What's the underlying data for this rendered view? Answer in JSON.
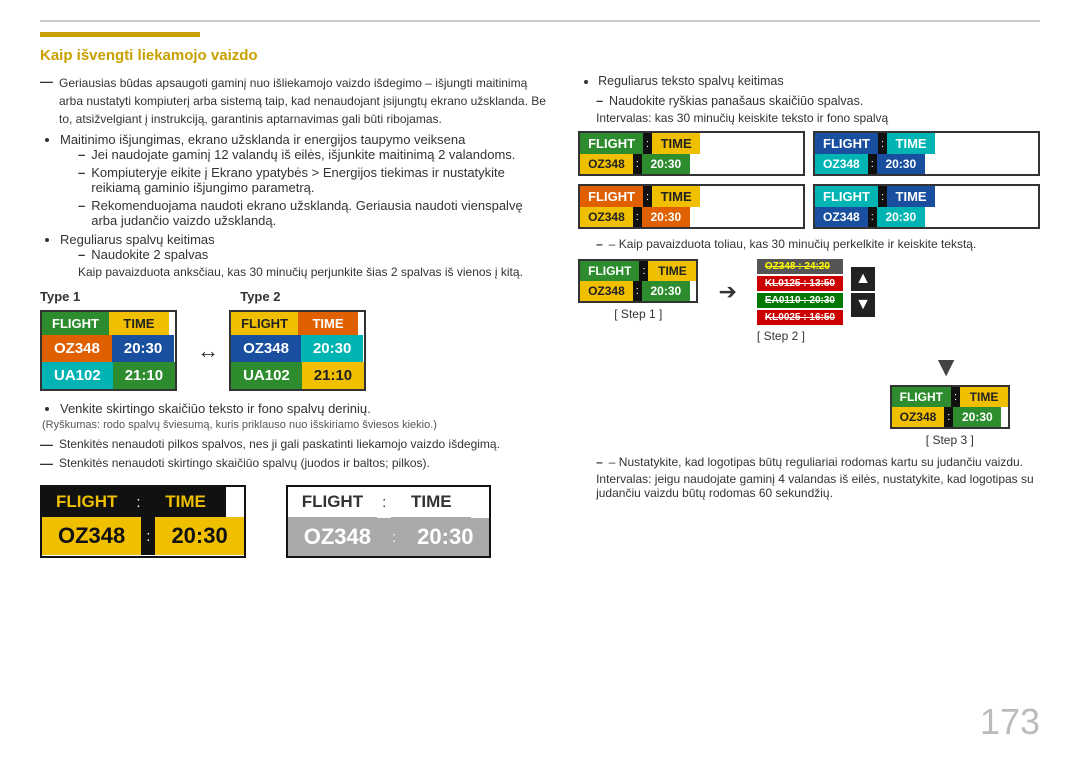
{
  "page": {
    "number": "173",
    "top_line": true
  },
  "header": {
    "bar_color": "#c8a000",
    "title": "Kaip išvengti liekamojo vaizdo"
  },
  "left_col": {
    "intro_dash": "Geriausias būdas apsaugoti gaminį nuo išliekamojo vaizdo išdegimo – išjungti maitinimą arba nustatyti kompiuterį arba sistemą taip, kad nenaudojant įsijungtų ekrano užsklanda. Be to, atsižvelgiant į instrukciją, garantinis aptarnavimas gali būti ribojamas.",
    "bullets": [
      {
        "text": "Maitinimo išjungimas, ekrano užsklanda ir energijos taupymo veiksena",
        "sub_dashes": [
          "Jei naudojate gaminį 12 valandų iš eilės, išjunkite maitinimą 2 valandoms.",
          "Kompiuteryje eikite į Ekrano ypatybės > Energijos tiekimas ir nustatykite reikiamą gaminio išjungimo parametrą.",
          "Rekomenduojama naudoti ekrano užsklandą. Geriausia naudoti vienspalvę arba judančio vaizdo užsklandą."
        ]
      },
      {
        "text": "Reguliarus spalvų keitimas",
        "sub_dashes": [
          "Naudokite 2 spalvas"
        ],
        "note": "Kaip pavaizduota anksčiau, kas 30 minučių perjunkite šias 2 spalvas iš vienos į kitą."
      }
    ],
    "type_labels": [
      "Type 1",
      "Type 2"
    ],
    "board1": {
      "header_left": "FLIGHT",
      "header_right": "TIME",
      "row2_left": "OZ348",
      "row2_right": "20:30",
      "row3_left": "UA102",
      "row3_right": "21:10"
    },
    "board2": {
      "header_left": "FLIGHT",
      "header_right": "TIME",
      "row2_left": "OZ348",
      "row2_right": "20:30",
      "row3_left": "UA102",
      "row3_right": "21:10"
    },
    "bullet2": [
      "Venkite skirtingo skaičiūo teksto ir fono spalvų derinių.",
      "(Ryškumas: rodo spalvų šviesumą, kuris priklauso nuo išskiriamo šviesos kiekio.)"
    ],
    "note1": "Stenkitės nenaudoti pilkos spalvos, nes ji gali paskatinti liekamojo vaizdo išdegimą.",
    "note2": "Stenkitės nenaudoti skirtingo skaičiūo spalvų (juodos ir baltos; pilkos).",
    "bottom_boards": {
      "board1": {
        "header_left": "FLIGHT",
        "colon": ":",
        "header_right": "TIME",
        "row2_left": "OZ348",
        "colon2": ":",
        "row2_right": "20:30",
        "style": "dark"
      },
      "board2": {
        "header_left": "FLIGHT",
        "colon": ":",
        "header_right": "TIME",
        "row2_left": "OZ348",
        "colon2": ":",
        "row2_right": "20:30",
        "style": "gray"
      }
    }
  },
  "right_col": {
    "note_top": "Reguliarus teksto spalvų keitimas",
    "note_sub": "Naudokite ryškias panašaus skaičiūo spalvas.",
    "note_interval": "Intervalas: kas 30 minučių keiskite teksto ir fono spalvą",
    "grid_boards": [
      {
        "header_left": "FLIGHT",
        "header_right": "TIME",
        "row2_left": "OZ348",
        "row2_right": "20:30",
        "style": "green_yellow"
      },
      {
        "header_left": "FLIGHT",
        "header_right": "TIME",
        "row2_left": "OZ348",
        "row2_right": "20:30",
        "style": "blue_cyan"
      },
      {
        "header_left": "FLIGHT",
        "header_right": "TIME",
        "row2_left": "OZ348",
        "row2_right": "20:30",
        "style": "orange_yellow"
      },
      {
        "header_left": "FLIGHT",
        "header_right": "TIME",
        "row2_left": "OZ348",
        "row2_right": "20:30",
        "style": "cyan_blue"
      }
    ],
    "step_note": "– Kaip pavaizduota toliau, kas 30 minučių perkelkite ir keiskite tekstą.",
    "step1_label": "[ Step 1 ]",
    "step2_label": "[ Step 2 ]",
    "step3_label": "[ Step 3 ]",
    "step1_board": {
      "header_left": "FLIGHT",
      "header_right": "TIME",
      "row2_left": "OZ348",
      "row2_right": "20:30"
    },
    "step2_crossed": [
      "OZ348 : 24:20",
      "KL0125 : 13:50",
      "EA0110 : 20:30",
      "KL0025 : 16:50"
    ],
    "step3_board": {
      "header_left": "FLIGHT",
      "header_right": "TIME",
      "row2_left": "OZ348",
      "row2_right": "20:30"
    },
    "final_notes": [
      "– Nustatykite, kad logotipas būtų reguliariai rodomas kartu su judančiu vaizdu.",
      "Intervalas: jeigu naudojate gaminį 4 valandas iš eilės, nustatykite, kad logotipas su judančiu vaizdu būtų rodomas 60 sekundžių."
    ]
  }
}
